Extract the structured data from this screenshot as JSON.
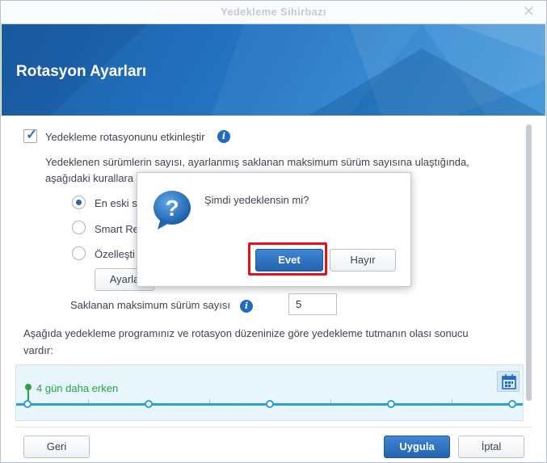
{
  "window": {
    "title": "Yedekleme Sihirbazı",
    "close_glyph": "✕"
  },
  "banner": {
    "heading": "Rotasyon Ayarları"
  },
  "rotation": {
    "enable_label": "Yedekleme rotasyonunu etkinleştir",
    "enabled": true,
    "description_line1": "Yedeklenen sürümlerin sayısı, ayarlanmış saklanan maksimum sürüm sayısına ulaştığında,",
    "description_line2": "aşağıdaki kurallara",
    "options": [
      {
        "label": "En eski s",
        "selected": true
      },
      {
        "label": "Smart Re",
        "selected": false
      },
      {
        "label": "Özelleşti",
        "selected": false
      }
    ],
    "settings_button": "Ayarla",
    "max_versions_label": "Saklanan maksimum sürüm sayısı",
    "max_versions_value": "5",
    "result_line1": "Aşağıda yedekleme programınız ve rotasyon düzeninize göre yedekleme tutmanın olası sonucu",
    "result_line2": "vardır:"
  },
  "timeline": {
    "marker_label": "4 gün daha erken",
    "calendar_icon": "calendar-icon"
  },
  "footer": {
    "back_label": "Geri",
    "apply_label": "Uygula",
    "cancel_label": "İptal"
  },
  "modal": {
    "icon": "question-icon",
    "message": "Şimdi yedeklensin mi?",
    "yes_label": "Evet",
    "no_label": "Hayır"
  },
  "colors": {
    "accent": "#2563ad",
    "banner": "#2474c2",
    "highlight": "#e4111a",
    "timeline_line": "#2e9fd6",
    "marker": "#27a24a"
  }
}
